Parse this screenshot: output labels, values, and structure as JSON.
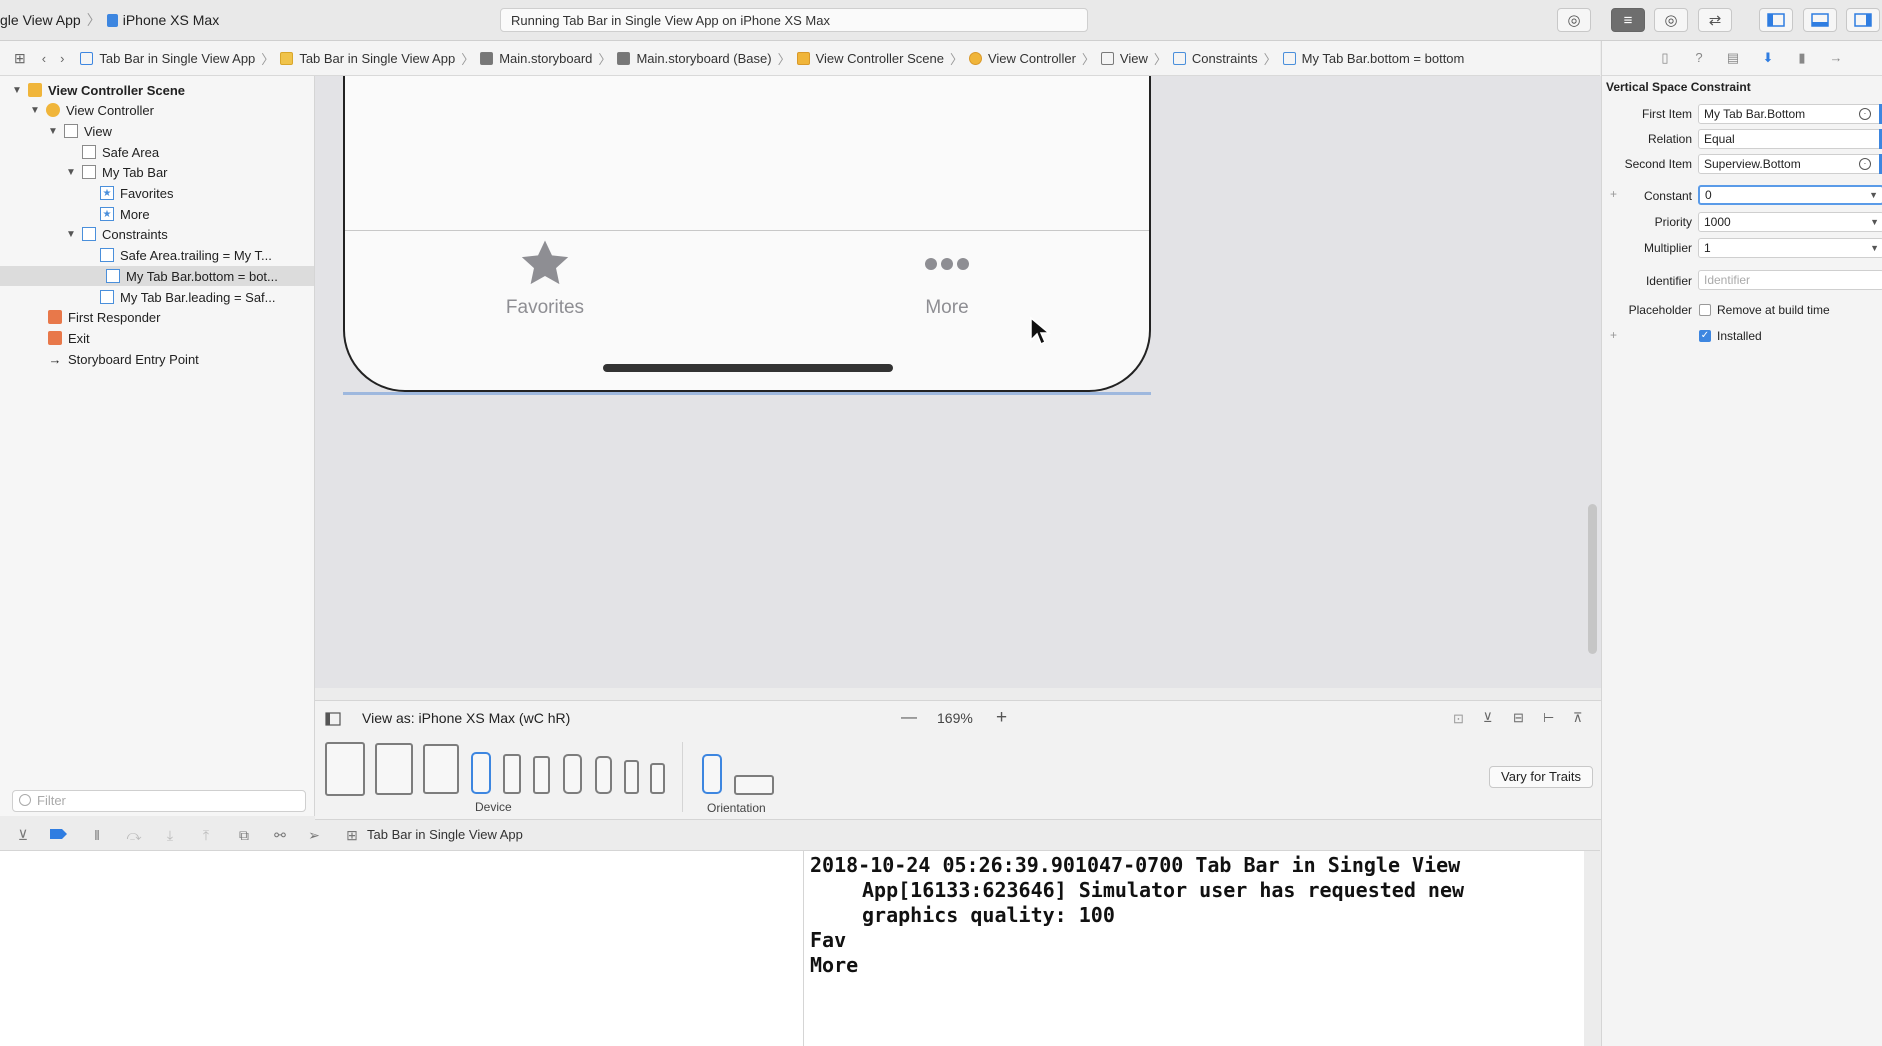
{
  "toolbar": {
    "scheme_app": "gle View App",
    "scheme_device": "iPhone XS Max",
    "activity": "Running Tab Bar in Single View App on iPhone XS Max"
  },
  "jumpbar": {
    "items": [
      "Tab Bar in Single View App",
      "Tab Bar in Single View App",
      "Main.storyboard",
      "Main.storyboard (Base)",
      "View Controller Scene",
      "View Controller",
      "View",
      "Constraints",
      "My Tab Bar.bottom = bottom"
    ]
  },
  "navigator": {
    "items": [
      "View Controller Scene",
      "View Controller",
      "View",
      "Safe Area",
      "My Tab Bar",
      "Favorites",
      "More",
      "Constraints",
      "Safe Area.trailing = My T...",
      "My Tab Bar.bottom = bot...",
      "My Tab Bar.leading = Saf...",
      "First Responder",
      "Exit",
      "Storyboard Entry Point"
    ],
    "filter_placeholder": "Filter"
  },
  "canvas": {
    "tab_favorites": "Favorites",
    "tab_more": "More",
    "view_as": "View as: iPhone XS Max (wC hR)",
    "zoom": "169%",
    "zoom_out": "—",
    "zoom_in": "+",
    "device_label": "Device",
    "orientation_label": "Orientation",
    "vary_for_traits": "Vary for Traits"
  },
  "debug": {
    "target": "Tab Bar in Single View App"
  },
  "console": {
    "line1": "2018-10-24 05:26:39.901047-0700 Tab Bar in Single View",
    "line2": "App[16133:623646] Simulator user has requested new",
    "line3": "graphics quality: 100",
    "line4": "Fav",
    "line5": "More"
  },
  "inspector": {
    "title": "Vertical Space Constraint",
    "first_item_label": "First Item",
    "first_item_value": "My Tab Bar.Bottom",
    "relation_label": "Relation",
    "relation_value": "Equal",
    "second_item_label": "Second Item",
    "second_item_value": "Superview.Bottom",
    "constant_label": "Constant",
    "constant_value": "0",
    "priority_label": "Priority",
    "priority_value": "1000",
    "multiplier_label": "Multiplier",
    "multiplier_value": "1",
    "identifier_label": "Identifier",
    "identifier_placeholder": "Identifier",
    "placeholder_label": "Placeholder",
    "remove_at_build_time": "Remove at build time",
    "installed_label": "Installed"
  },
  "colors": {
    "accent": "#3d86e0",
    "scene_icon": "#f0b53a",
    "responder_icon": "#e8784a"
  }
}
